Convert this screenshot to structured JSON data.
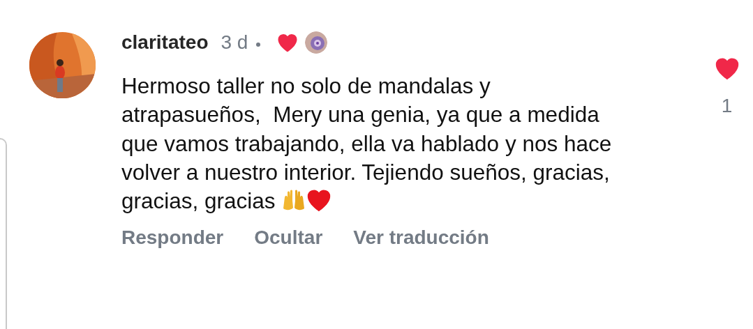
{
  "comment": {
    "username": "claritateo",
    "time": "3 d",
    "liked_by_author": true,
    "text": "Hermoso taller no solo de mandalas y atrapasueños,  Mery una genia, ya que a medida que vamos trabajando, ella va hablado y nos hace volver a nuestro interior. Tejiendo sueños, gracias, gracias, gracias",
    "like": {
      "liked": true,
      "count": "1"
    },
    "actions": [
      "Responder",
      "Ocultar",
      "Ver traducción"
    ]
  }
}
